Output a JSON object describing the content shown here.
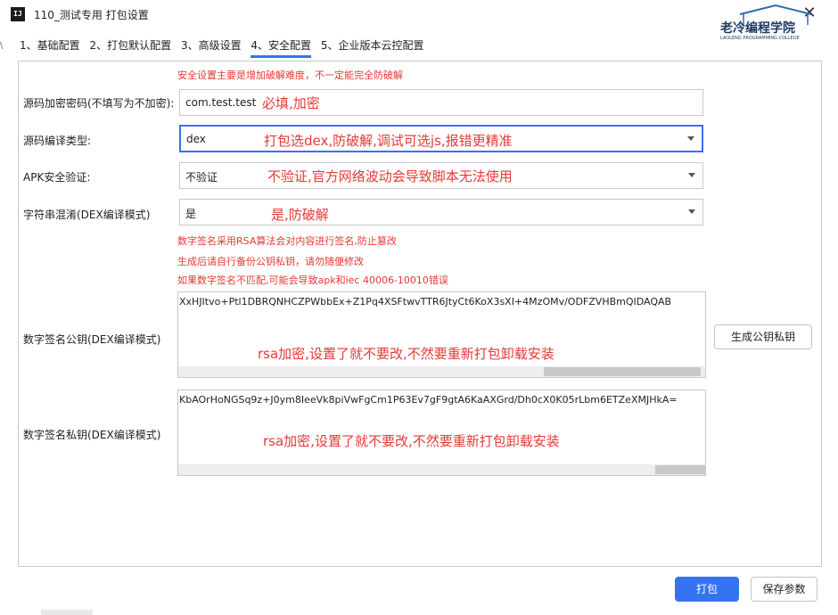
{
  "window": {
    "title": "110_测试专用 打包设置",
    "app_icon_text": "IJ",
    "close_glyph": "✕",
    "left_edge_text": "\\"
  },
  "logo": {
    "text": "老冷编程学院",
    "subtext": "LAOLENG PROGRAMMING COLLEGE",
    "color": "#1e3a5f"
  },
  "tabs": [
    {
      "label": "1、基础配置"
    },
    {
      "label": "2、打包默认配置"
    },
    {
      "label": "3、高级设置"
    },
    {
      "label": "4、安全配置",
      "active": true
    },
    {
      "label": "5、企业版本云控配置"
    }
  ],
  "security": {
    "top_warning": "安全设置主要是增加破解难度，不一定能完全防破解",
    "password": {
      "label": "源码加密密码(不填写为不加密):",
      "value": "com.test.test",
      "note": "必填,加密"
    },
    "compile_type": {
      "label": "源码编译类型:",
      "value": "dex",
      "note": "打包选dex,防破解,调试可选js,报错更精准"
    },
    "apk_verify": {
      "label": "APK安全验证:",
      "value": "不验证",
      "note": "不验证,官方网络波动会导致脚本无法使用"
    },
    "string_obfuscate": {
      "label": "字符串混淆(DEX编译模式)",
      "value": "是",
      "note": "是,防破解"
    },
    "signature_notes": [
      "数字签名采用RSA算法会对内容进行签名,防止篡改",
      "生成后请自行备份公钥私钥，请勿随便修改",
      "如果数字签名不匹配,可能会导致apk和iec 40006-10010错误"
    ],
    "public_key": {
      "label": "数字签名公钥(DEX编译模式)",
      "value": "XxHJItvo+Ptl1DBRQNHCZPWbbEx+Z1Pq4XSFtwvTTR6JtyCt6KoX3sXI+4MzOMv/ODFZVHBmQIDAQAB",
      "note": "rsa加密,设置了就不要改,不然要重新打包卸载安装"
    },
    "private_key": {
      "label": "数字签名私钥(DEX编译模式)",
      "value": "KbAOrHoNGSq9z+J0ym8IeeVk8piVwFgCm1P63Ev7gF9gtA6KaAXGrd/Dh0cX0K05rLbm6ETZeXMJHkA=",
      "note": "rsa加密,设置了就不要改,不然要重新打包卸载安装"
    },
    "generate_button": "生成公钥私钥"
  },
  "footer": {
    "build_button": "打包",
    "save_button": "保存参数"
  },
  "colors": {
    "accent": "#3574f0",
    "warning": "#e53935",
    "border": "#c8c8c8"
  }
}
